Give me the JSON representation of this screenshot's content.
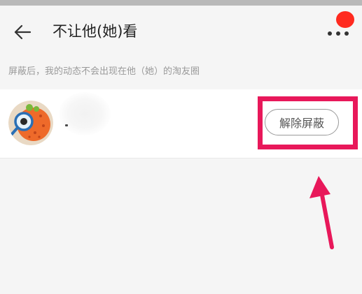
{
  "header": {
    "back_icon": "arrow-left-icon",
    "title": "不让他(她)看",
    "more_icon": "more-dots-icon",
    "badge_color": "#ff2a1f"
  },
  "notice": {
    "text": "屏蔽后，我的动态不会出现在他（她）的淘友圈"
  },
  "blocked_list": [
    {
      "avatar_icon": "cartoon-avatar-icon",
      "name": "",
      "action_label": "解除屏蔽"
    }
  ],
  "annotation": {
    "highlight_color": "#e8185a",
    "arrow_icon": "pointer-arrow-icon"
  }
}
